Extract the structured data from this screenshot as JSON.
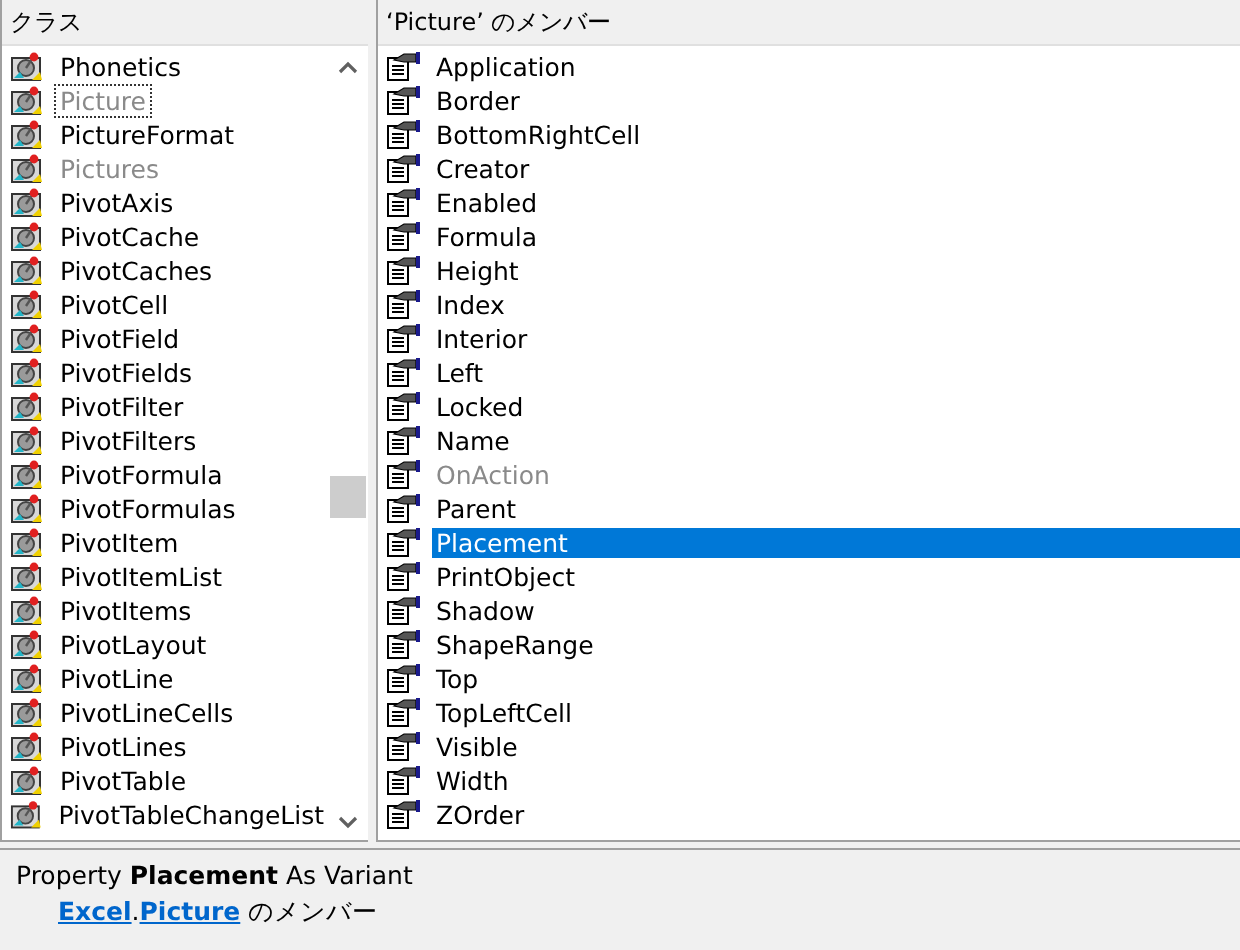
{
  "classes": {
    "header": "クラス",
    "items": [
      {
        "name": "Phonetics",
        "dimmed": false,
        "selected": false
      },
      {
        "name": "Picture",
        "dimmed": true,
        "selected": true
      },
      {
        "name": "PictureFormat",
        "dimmed": false,
        "selected": false
      },
      {
        "name": "Pictures",
        "dimmed": true,
        "selected": false
      },
      {
        "name": "PivotAxis",
        "dimmed": false,
        "selected": false
      },
      {
        "name": "PivotCache",
        "dimmed": false,
        "selected": false
      },
      {
        "name": "PivotCaches",
        "dimmed": false,
        "selected": false
      },
      {
        "name": "PivotCell",
        "dimmed": false,
        "selected": false
      },
      {
        "name": "PivotField",
        "dimmed": false,
        "selected": false
      },
      {
        "name": "PivotFields",
        "dimmed": false,
        "selected": false
      },
      {
        "name": "PivotFilter",
        "dimmed": false,
        "selected": false
      },
      {
        "name": "PivotFilters",
        "dimmed": false,
        "selected": false
      },
      {
        "name": "PivotFormula",
        "dimmed": false,
        "selected": false
      },
      {
        "name": "PivotFormulas",
        "dimmed": false,
        "selected": false
      },
      {
        "name": "PivotItem",
        "dimmed": false,
        "selected": false
      },
      {
        "name": "PivotItemList",
        "dimmed": false,
        "selected": false
      },
      {
        "name": "PivotItems",
        "dimmed": false,
        "selected": false
      },
      {
        "name": "PivotLayout",
        "dimmed": false,
        "selected": false
      },
      {
        "name": "PivotLine",
        "dimmed": false,
        "selected": false
      },
      {
        "name": "PivotLineCells",
        "dimmed": false,
        "selected": false
      },
      {
        "name": "PivotLines",
        "dimmed": false,
        "selected": false
      },
      {
        "name": "PivotTable",
        "dimmed": false,
        "selected": false
      },
      {
        "name": "PivotTableChangeList",
        "dimmed": false,
        "selected": false
      }
    ]
  },
  "members": {
    "header": "‘Picture’ のメンバー",
    "items": [
      {
        "name": "Application",
        "dimmed": false,
        "selected": false
      },
      {
        "name": "Border",
        "dimmed": false,
        "selected": false
      },
      {
        "name": "BottomRightCell",
        "dimmed": false,
        "selected": false
      },
      {
        "name": "Creator",
        "dimmed": false,
        "selected": false
      },
      {
        "name": "Enabled",
        "dimmed": false,
        "selected": false
      },
      {
        "name": "Formula",
        "dimmed": false,
        "selected": false
      },
      {
        "name": "Height",
        "dimmed": false,
        "selected": false
      },
      {
        "name": "Index",
        "dimmed": false,
        "selected": false
      },
      {
        "name": "Interior",
        "dimmed": false,
        "selected": false
      },
      {
        "name": "Left",
        "dimmed": false,
        "selected": false
      },
      {
        "name": "Locked",
        "dimmed": false,
        "selected": false
      },
      {
        "name": "Name",
        "dimmed": false,
        "selected": false
      },
      {
        "name": "OnAction",
        "dimmed": true,
        "selected": false
      },
      {
        "name": "Parent",
        "dimmed": false,
        "selected": false
      },
      {
        "name": "Placement",
        "dimmed": false,
        "selected": true
      },
      {
        "name": "PrintObject",
        "dimmed": false,
        "selected": false
      },
      {
        "name": "Shadow",
        "dimmed": false,
        "selected": false
      },
      {
        "name": "ShapeRange",
        "dimmed": false,
        "selected": false
      },
      {
        "name": "Top",
        "dimmed": false,
        "selected": false
      },
      {
        "name": "TopLeftCell",
        "dimmed": false,
        "selected": false
      },
      {
        "name": "Visible",
        "dimmed": false,
        "selected": false
      },
      {
        "name": "Width",
        "dimmed": false,
        "selected": false
      },
      {
        "name": "ZOrder",
        "dimmed": false,
        "selected": false
      }
    ]
  },
  "details": {
    "signature": "Property **Placement** As Variant",
    "library_link": "Excel",
    "separator": ".",
    "class_link": "Picture",
    "suffix": "のメンバー"
  }
}
